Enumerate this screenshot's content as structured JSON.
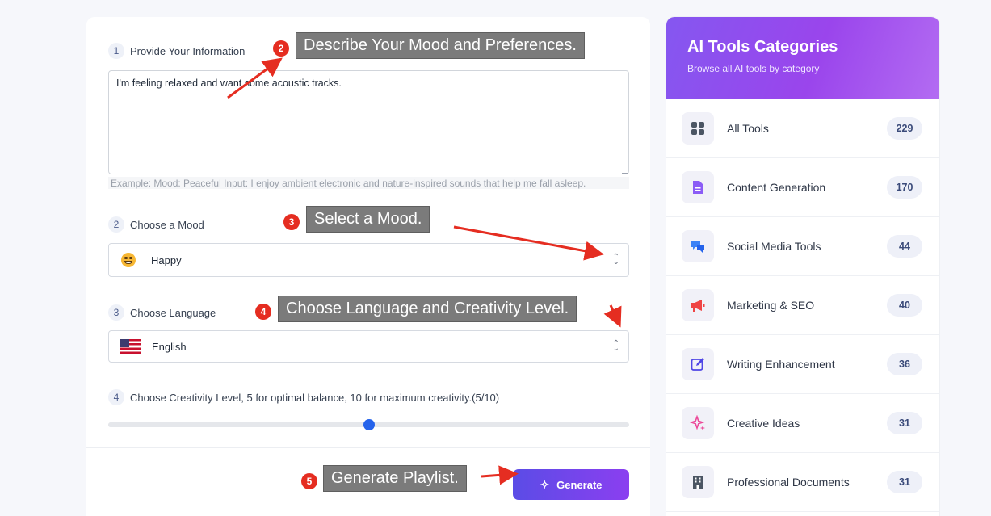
{
  "form": {
    "steps": [
      {
        "num": "1",
        "label": "Provide Your Information"
      },
      {
        "num": "2",
        "label": "Choose a Mood"
      },
      {
        "num": "3",
        "label": "Choose Language"
      },
      {
        "num": "4",
        "label": "Choose Creativity Level, 5 for optimal balance, 10 for maximum creativity.(5/10)"
      }
    ],
    "textarea_value": "I'm feeling relaxed and want some acoustic tracks.",
    "hint": "Example:  Mood: Peaceful Input: I enjoy ambient electronic and nature-inspired sounds that help me fall asleep.",
    "mood_selected": "Happy",
    "mood_icon": "smiling-face-emoji",
    "language_selected": "English",
    "language_icon": "us-flag",
    "creativity": {
      "value": 5,
      "max": 10
    },
    "generate_label": "Generate"
  },
  "sidebar": {
    "title": "AI Tools Categories",
    "subtitle": "Browse all AI tools by category",
    "gradient": [
      "#8557f0",
      "#b36cf2"
    ],
    "items": [
      {
        "label": "All Tools",
        "count": "229",
        "icon": "grid-icon"
      },
      {
        "label": "Content Generation",
        "count": "170",
        "icon": "document-icon"
      },
      {
        "label": "Social Media Tools",
        "count": "44",
        "icon": "chat-icon"
      },
      {
        "label": "Marketing & SEO",
        "count": "40",
        "icon": "megaphone-icon"
      },
      {
        "label": "Writing Enhancement",
        "count": "36",
        "icon": "edit-icon"
      },
      {
        "label": "Creative Ideas",
        "count": "31",
        "icon": "sparkle-icon"
      },
      {
        "label": "Professional Documents",
        "count": "31",
        "icon": "building-icon"
      }
    ]
  },
  "annotations": [
    {
      "num": "2",
      "text": "Describe Your Mood and Preferences."
    },
    {
      "num": "3",
      "text": "Select a Mood."
    },
    {
      "num": "4",
      "text": "Choose Language and Creativity Level."
    },
    {
      "num": "5",
      "text": "Generate Playlist."
    }
  ],
  "colors": {
    "accent": "#5b4ce6",
    "annotation_red": "#e52d21",
    "slider": "#2563eb"
  }
}
